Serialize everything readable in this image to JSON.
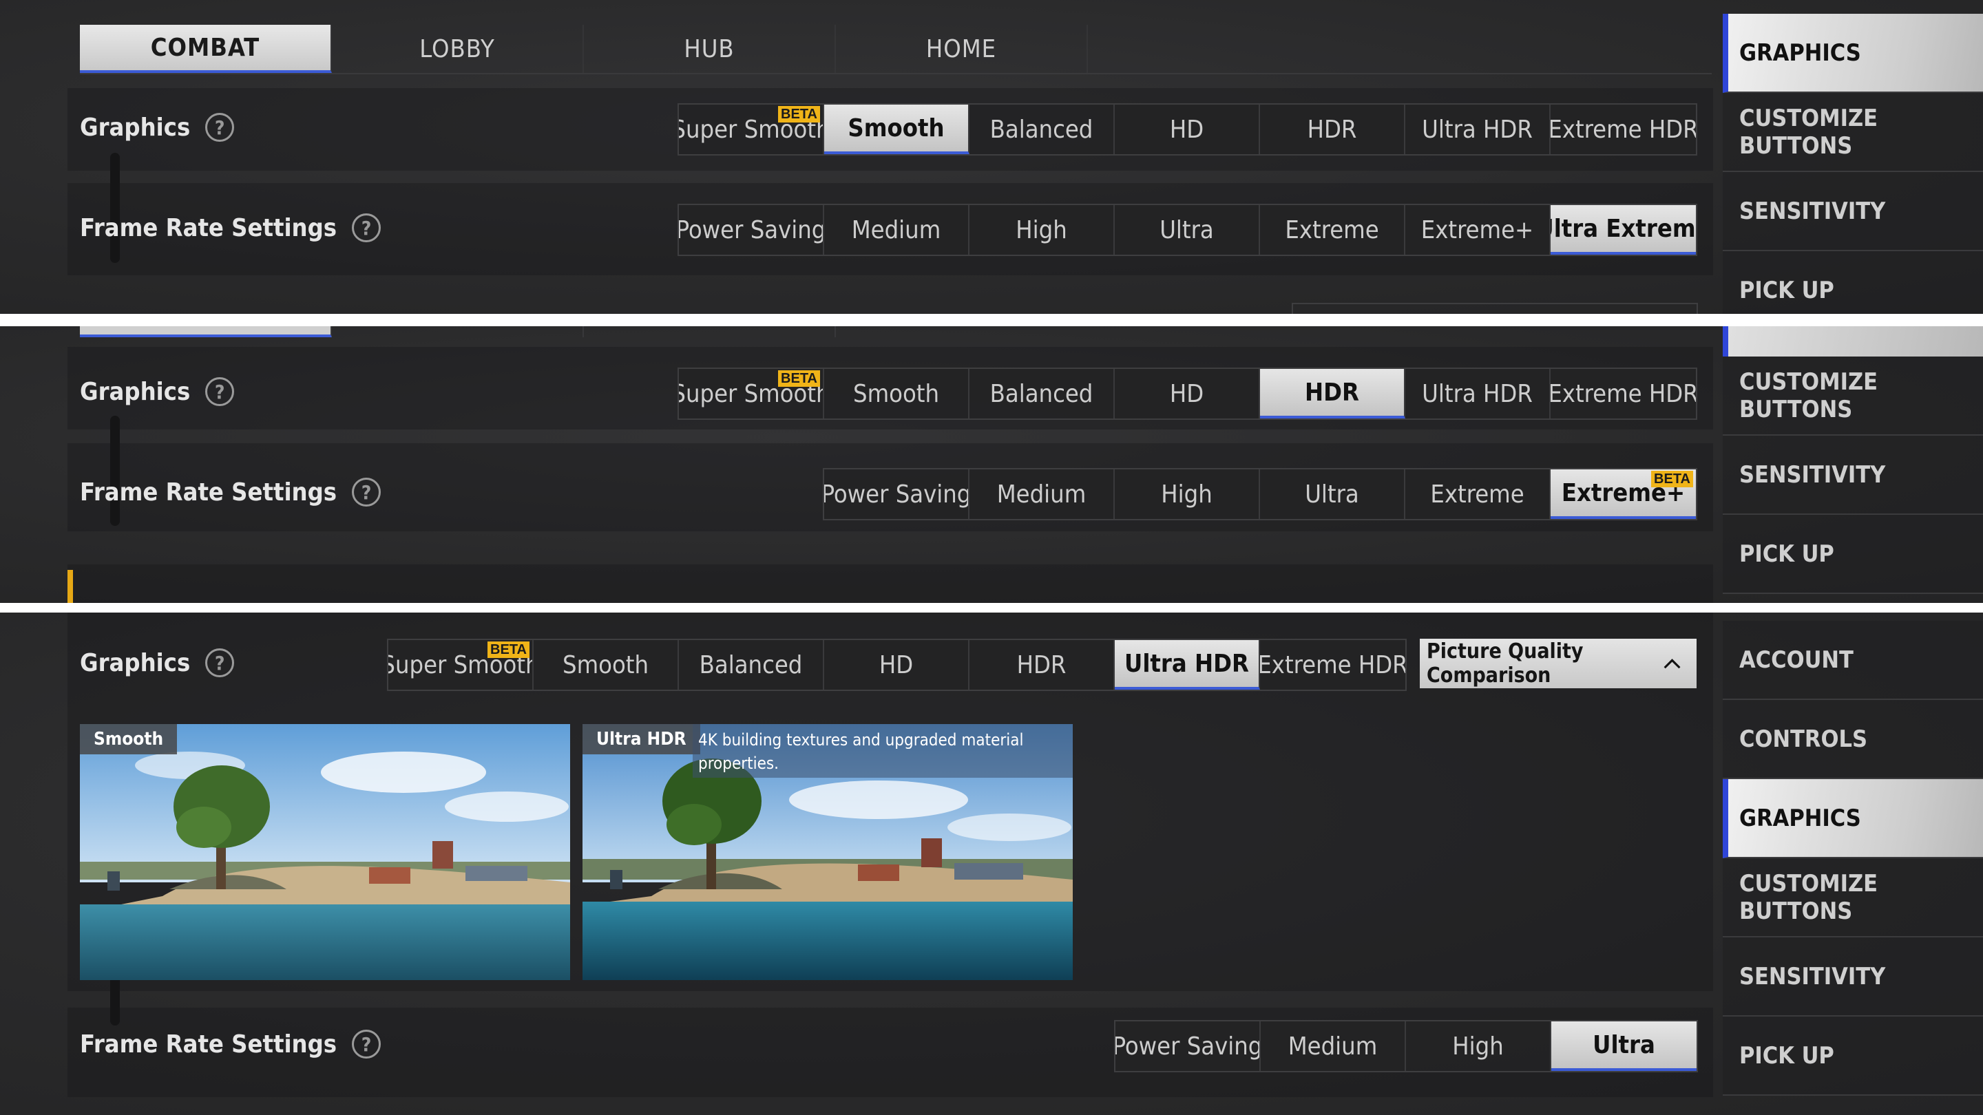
{
  "panel1": {
    "tabs": [
      "COMBAT",
      "LOBBY",
      "HUB",
      "HOME"
    ],
    "graphics_label": "Graphics",
    "graphics_options": [
      "Super Smooth",
      "Smooth",
      "Balanced",
      "HD",
      "HDR",
      "Ultra HDR",
      "Extreme HDR"
    ],
    "graphics_selected": "Smooth",
    "frame_label": "Frame Rate Settings",
    "frame_options": [
      "Power Saving",
      "Medium",
      "High",
      "Ultra",
      "Extreme",
      "Extreme+",
      "Ultra Extreme"
    ],
    "frame_selected": "Ultra Extreme",
    "sidebar": [
      "GRAPHICS",
      "CUSTOMIZE BUTTONS",
      "SENSITIVITY",
      "PICK UP"
    ]
  },
  "panel2": {
    "graphics_label": "Graphics",
    "graphics_options": [
      "Super Smooth",
      "Smooth",
      "Balanced",
      "HD",
      "HDR",
      "Ultra HDR",
      "Extreme HDR"
    ],
    "graphics_selected": "HDR",
    "frame_label": "Frame Rate Settings",
    "frame_options": [
      "Power Saving",
      "Medium",
      "High",
      "Ultra",
      "Extreme",
      "Extreme+"
    ],
    "frame_selected": "Extreme+",
    "sidebar": [
      "CUSTOMIZE BUTTONS",
      "SENSITIVITY",
      "PICK UP"
    ]
  },
  "panel3": {
    "graphics_label": "Graphics",
    "graphics_options": [
      "Super Smooth",
      "Smooth",
      "Balanced",
      "HD",
      "HDR",
      "Ultra HDR",
      "Extreme HDR"
    ],
    "graphics_selected": "Ultra HDR",
    "comparison_button": "Picture Quality Comparison",
    "left_preview_tag": "Smooth",
    "right_preview_tag": "Ultra HDR",
    "right_preview_desc": "4K building textures and upgraded material properties.",
    "frame_label": "Frame Rate Settings",
    "frame_options": [
      "Power Saving",
      "Medium",
      "High",
      "Ultra"
    ],
    "frame_selected": "Ultra",
    "sidebar": [
      "ACCOUNT",
      "CONTROLS",
      "GRAPHICS",
      "CUSTOMIZE BUTTONS",
      "SENSITIVITY",
      "PICK UP"
    ],
    "sidebar_selected": "GRAPHICS"
  },
  "badge_text": "BETA",
  "icons": {
    "help": "question-circle-icon",
    "collapse": "chevron-up-icon"
  },
  "colors": {
    "accent": "#3b5bd6",
    "badge": "#f0b418",
    "selected_bg": "#d6d6d6"
  }
}
